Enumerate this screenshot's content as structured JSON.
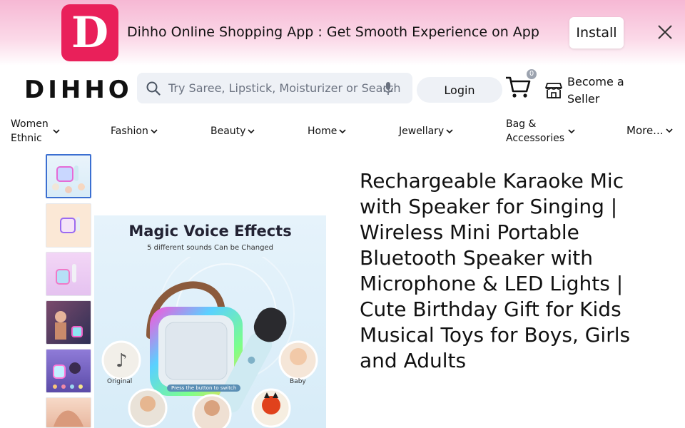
{
  "banner": {
    "logo_letter": "D",
    "text": "Dihho Online Shopping App : Get Smooth Experience on App",
    "install_label": "Install",
    "brand_color": "#e9205a"
  },
  "header": {
    "brand": "DIHHO",
    "search_placeholder": "Try Saree, Lipstick, Moisturizer or Search by",
    "login_label": "Login",
    "cart_count": "0",
    "seller_label": "Become a Seller"
  },
  "nav": {
    "items": [
      {
        "label": "Women Ethnic"
      },
      {
        "label": "Fashion"
      },
      {
        "label": "Beauty"
      },
      {
        "label": "Home"
      },
      {
        "label": "Jewellary"
      },
      {
        "label": "Bag & Accessories"
      },
      {
        "label": "More..."
      }
    ]
  },
  "gallery": {
    "main_image": {
      "title": "Magic Voice Effects",
      "subtitle": "5 different sounds Can be Changed",
      "captions": [
        "Original",
        "Baby"
      ],
      "button_text": "Press the button to switch"
    }
  },
  "product": {
    "title": "Rechargeable Karaoke Mic with Speaker for Singing | Wireless Mini Portable Bluetooth Speaker with Microphone & LED Lights | Cute Birthday Gift for Kids Musical Toys for Boys, Girls and Adults"
  }
}
